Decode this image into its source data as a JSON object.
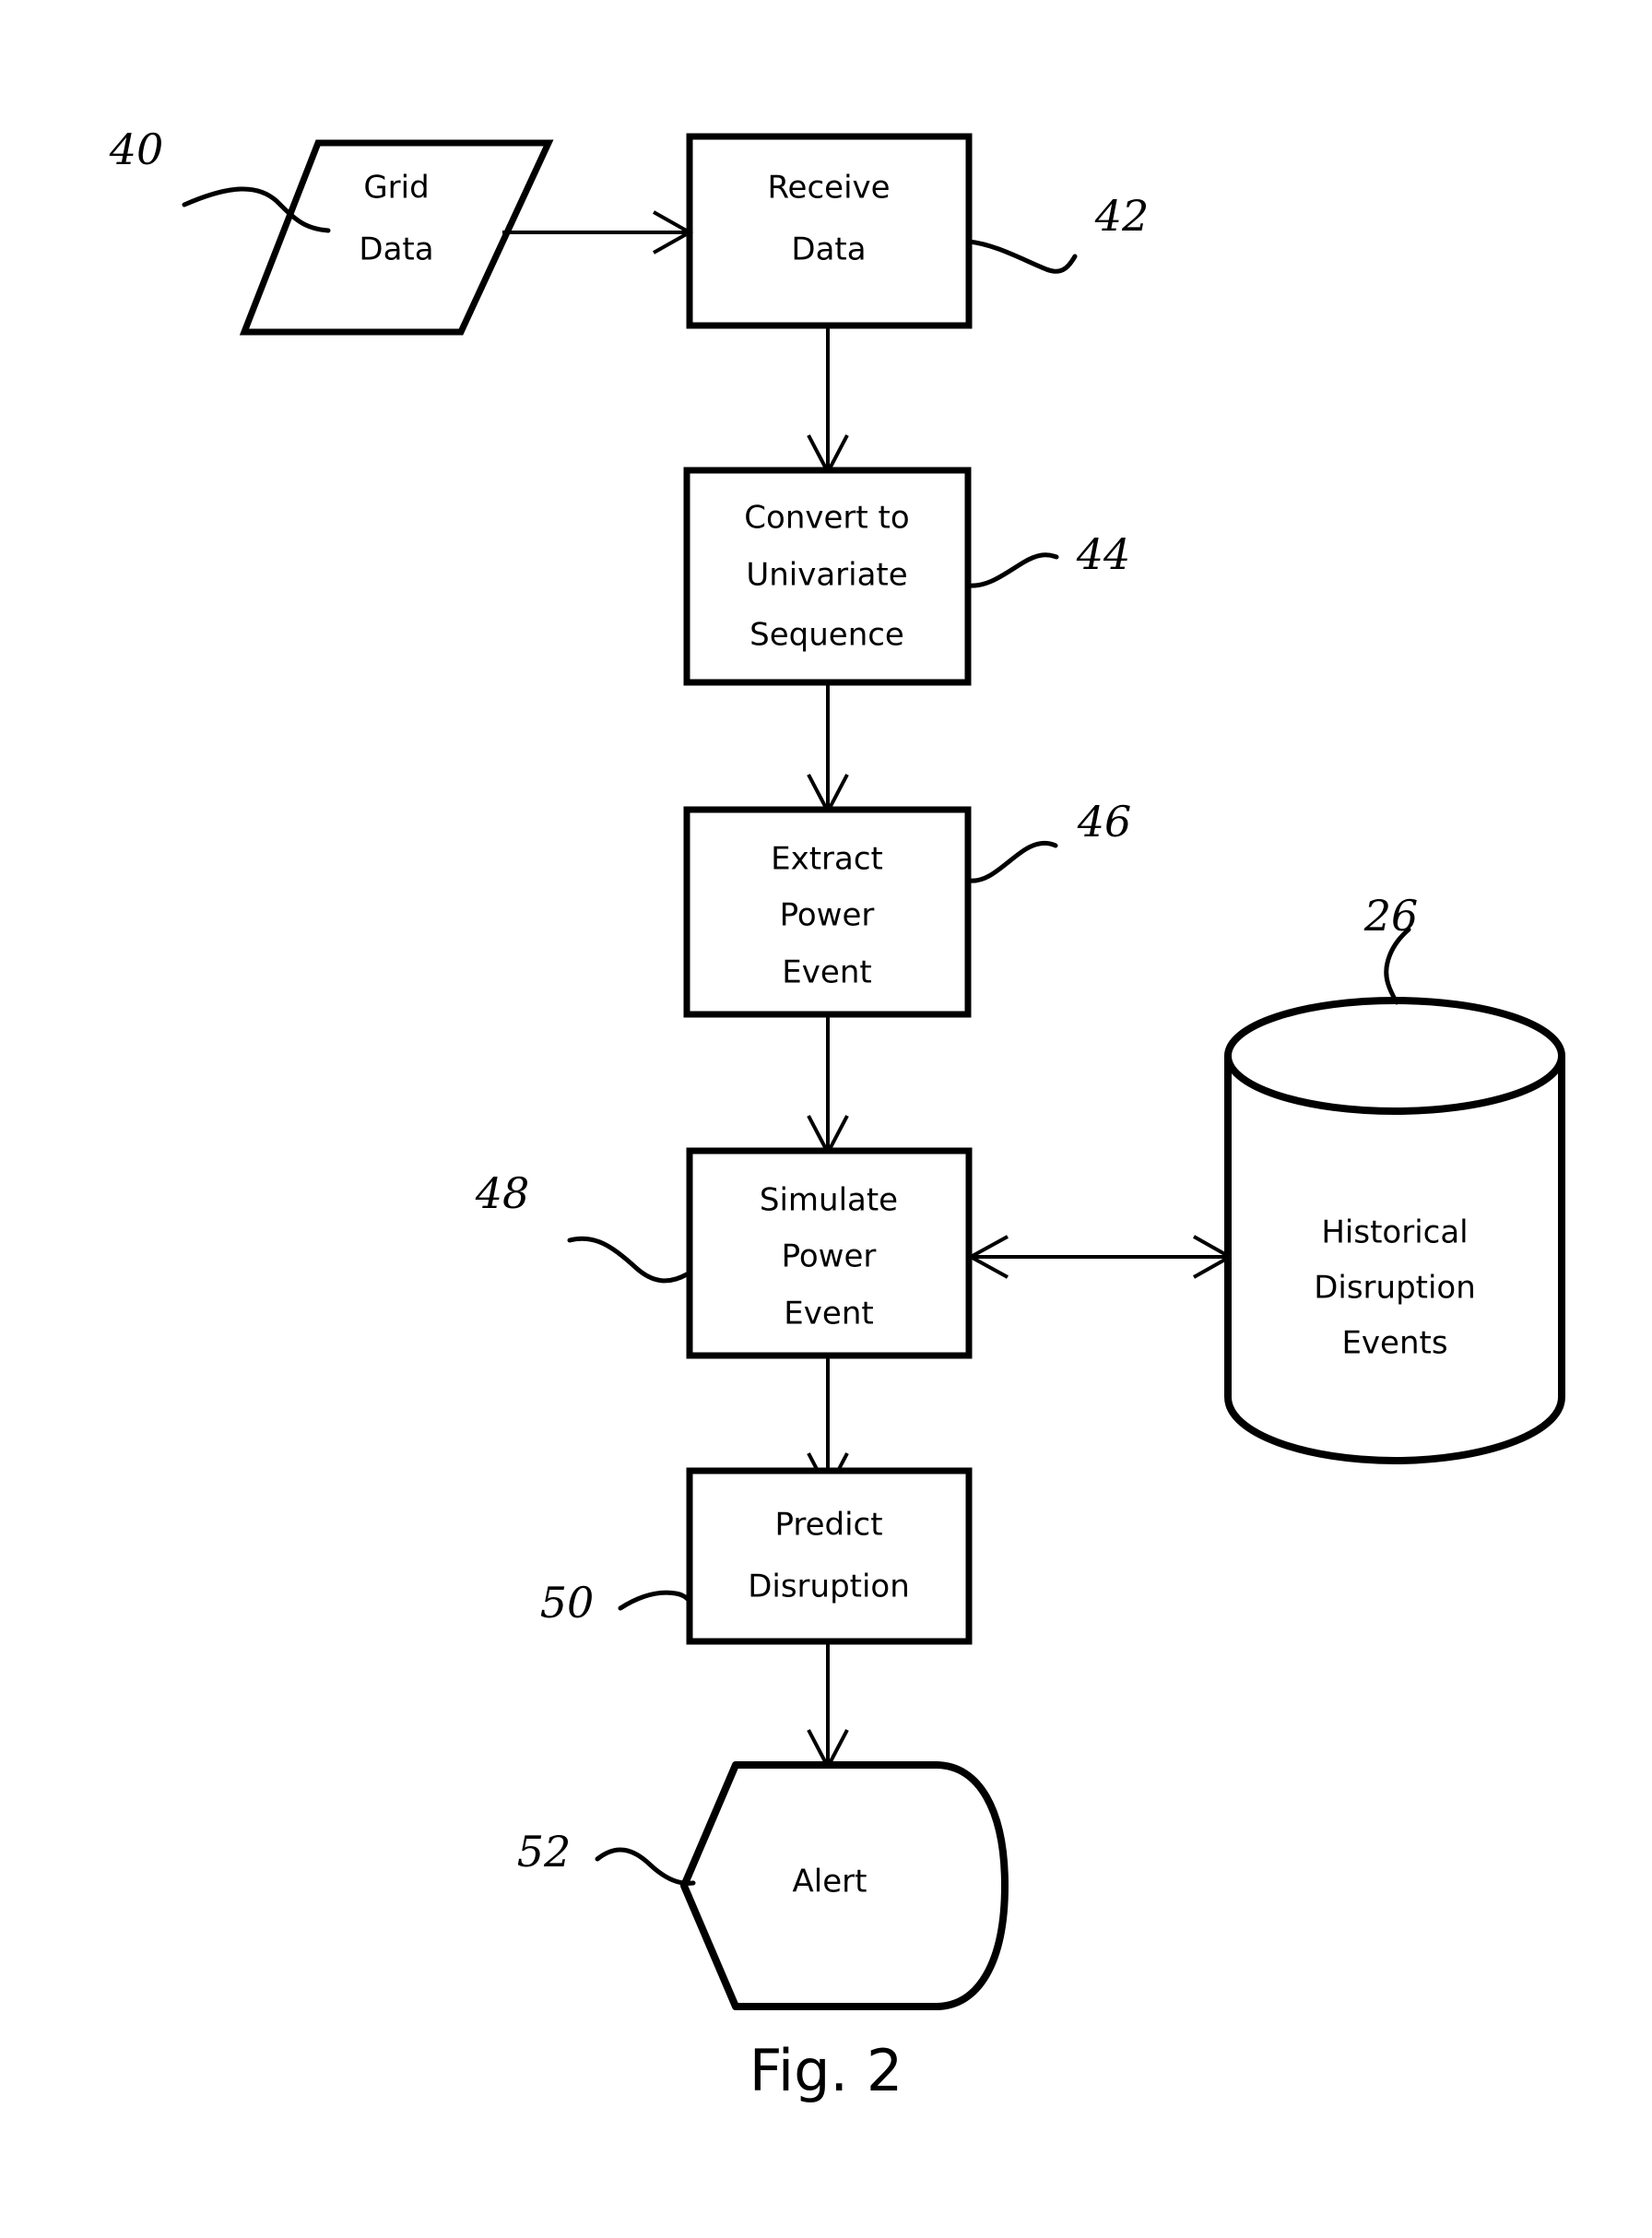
{
  "figure": {
    "caption": "Fig. 2",
    "type": "patent-flowchart"
  },
  "nodes": [
    {
      "id": "grid-data",
      "shape": "parallelogram",
      "lines": [
        "Grid",
        "Data"
      ],
      "ref": "40"
    },
    {
      "id": "receive-data",
      "shape": "process",
      "lines": [
        "Receive",
        "Data"
      ],
      "ref": "42"
    },
    {
      "id": "convert-univariate-sequence",
      "shape": "process",
      "lines": [
        "Convert to",
        "Univariate",
        "Sequence"
      ],
      "ref": "44"
    },
    {
      "id": "extract-power-event",
      "shape": "process",
      "lines": [
        "Extract",
        "Power",
        "Event"
      ],
      "ref": "46"
    },
    {
      "id": "simulate-power-event",
      "shape": "process",
      "lines": [
        "Simulate",
        "Power",
        "Event"
      ],
      "ref": "48"
    },
    {
      "id": "historical-disruption-events",
      "shape": "cylinder",
      "lines": [
        "Historical",
        "Disruption",
        "Events"
      ],
      "ref": "26"
    },
    {
      "id": "predict-disruption",
      "shape": "process",
      "lines": [
        "Predict",
        "Disruption"
      ],
      "ref": "50"
    },
    {
      "id": "alert",
      "shape": "display",
      "lines": [
        "Alert"
      ],
      "ref": "52"
    }
  ],
  "labels": {
    "grid_data_l1": "Grid",
    "grid_data_l2": "Data",
    "receive_data_l1": "Receive",
    "receive_data_l2": "Data",
    "convert_l1": "Convert to",
    "convert_l2": "Univariate",
    "convert_l3": "Sequence",
    "extract_l1": "Extract",
    "extract_l2": "Power",
    "extract_l3": "Event",
    "simulate_l1": "Simulate",
    "simulate_l2": "Power",
    "simulate_l3": "Event",
    "historical_l1": "Historical",
    "historical_l2": "Disruption",
    "historical_l3": "Events",
    "predict_l1": "Predict",
    "predict_l2": "Disruption",
    "alert_l1": "Alert"
  },
  "refs": {
    "grid_data": "40",
    "receive_data": "42",
    "convert": "44",
    "extract": "46",
    "simulate": "48",
    "historical": "26",
    "predict": "50",
    "alert": "52"
  },
  "edges": [
    {
      "from": "grid-data",
      "to": "receive-data",
      "direction": "one-way",
      "orientation": "horizontal"
    },
    {
      "from": "receive-data",
      "to": "convert-univariate-sequence",
      "direction": "one-way",
      "orientation": "vertical"
    },
    {
      "from": "convert-univariate-sequence",
      "to": "extract-power-event",
      "direction": "one-way",
      "orientation": "vertical"
    },
    {
      "from": "extract-power-event",
      "to": "simulate-power-event",
      "direction": "one-way",
      "orientation": "vertical"
    },
    {
      "from": "simulate-power-event",
      "to": "historical-disruption-events",
      "direction": "two-way",
      "orientation": "horizontal"
    },
    {
      "from": "simulate-power-event",
      "to": "predict-disruption",
      "direction": "one-way",
      "orientation": "vertical"
    },
    {
      "from": "predict-disruption",
      "to": "alert",
      "direction": "one-way",
      "orientation": "vertical"
    }
  ],
  "colors": {
    "background": "#ffffff",
    "stroke": "#000000",
    "text": "#000000"
  }
}
